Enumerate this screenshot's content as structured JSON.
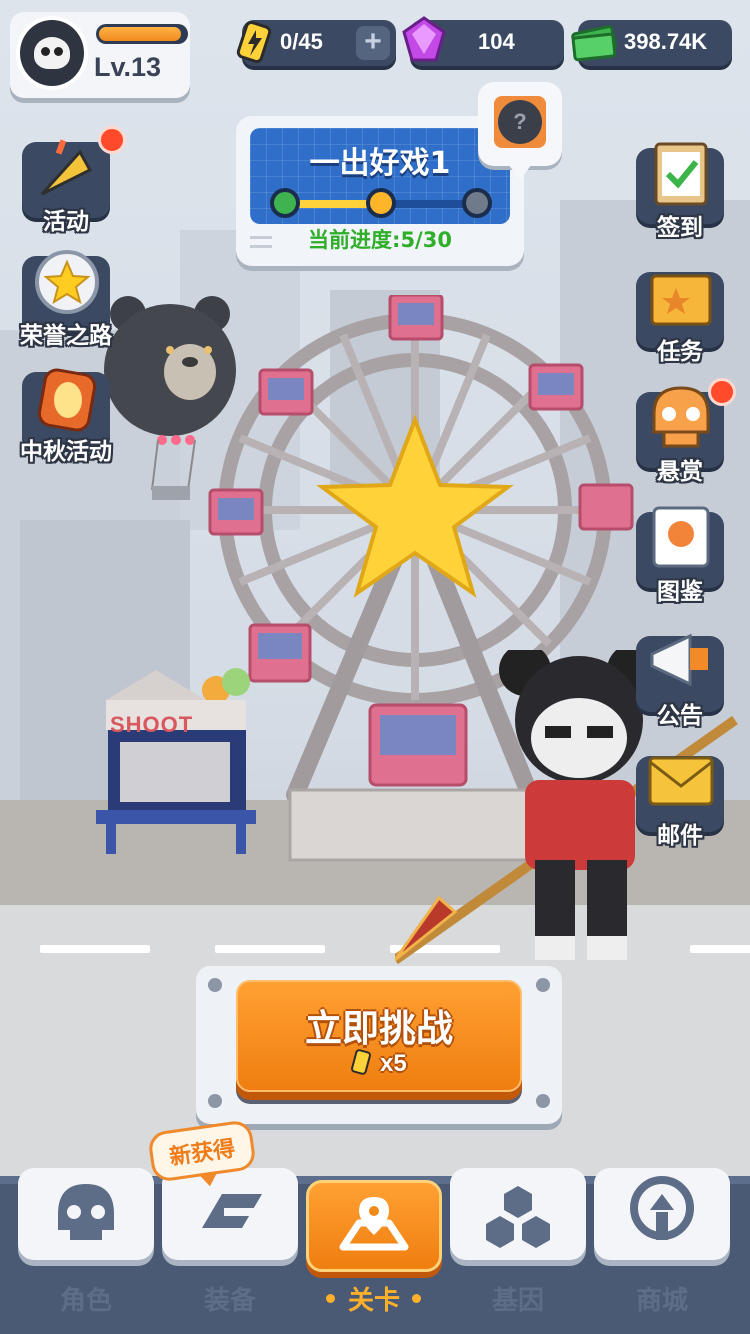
{
  "player": {
    "level": "Lv.13",
    "xp_fraction": 0.95
  },
  "resources": {
    "energy": "0/45",
    "gems": "104",
    "cash": "398.74K"
  },
  "level_panel": {
    "title": "一出好戏1",
    "progress_text": "当前进度:5/30",
    "stage_nodes": 3,
    "current_node": 2,
    "unknown_reward": "?"
  },
  "left_menu": [
    {
      "label": "活动",
      "icon": "party-popper-icon",
      "notification": true
    },
    {
      "label": "荣誉之路",
      "icon": "star-medal-icon",
      "notification": false
    },
    {
      "label": "中秋活动",
      "icon": "lantern-icon",
      "notification": false
    }
  ],
  "right_menu": [
    {
      "label": "签到",
      "icon": "clipboard-check-icon",
      "notification": false
    },
    {
      "label": "任务",
      "icon": "folder-star-icon",
      "notification": false
    },
    {
      "label": "悬赏",
      "icon": "skull-bounty-icon",
      "notification": true
    },
    {
      "label": "图鉴",
      "icon": "notebook-icon",
      "notification": false
    },
    {
      "label": "公告",
      "icon": "megaphone-icon",
      "notification": false
    },
    {
      "label": "邮件",
      "icon": "envelope-icon",
      "notification": false
    }
  ],
  "scene": {
    "booth_sign": "SHOOT"
  },
  "challenge": {
    "label": "立即挑战",
    "cost": "x5"
  },
  "new_badge": "新获得",
  "tabs": [
    {
      "label": "角色",
      "icon": "skull-icon",
      "active": false
    },
    {
      "label": "装备",
      "icon": "equipment-icon",
      "active": false
    },
    {
      "label": "关卡",
      "icon": "map-pin-icon",
      "active": true
    },
    {
      "label": "基因",
      "icon": "hexagon-cluster-icon",
      "active": false
    },
    {
      "label": "商城",
      "icon": "shop-icon",
      "active": false
    }
  ],
  "colors": {
    "accent_orange": "#f28a1a",
    "panel_dark": "#3b4a62",
    "progress_green": "#2fae2a",
    "level_blue": "#2f6fc9"
  }
}
